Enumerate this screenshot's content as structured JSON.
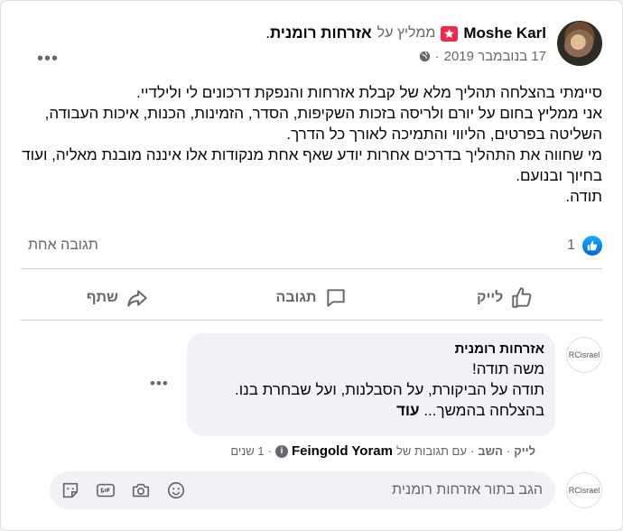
{
  "post": {
    "author_name": "Moshe Karl",
    "recommends_text": "ממליץ על",
    "page_name": "אזרחות רומנית",
    "page_name_suffix": ".",
    "date": "17 בנובמבר 2019",
    "date_separator": "·",
    "more_label": "•••",
    "body_lines": [
      "סיימתי בהצלחה תהליך מלא של קבלת אזרחות והנפקת דרכונים לי ולילדיי.",
      "אני ממליץ בחום על יורם ולריסה בזכות השקיפות, הסדר, הזמינות, הכנות, איכות העבודה, השליטה בפרטים, הליווי והתמיכה לאורך כל הדרך.",
      "מי שחווה את התהליך בדרכים אחרות יודע שאף אחת מנקודות אלו איננה מובנת מאליה, ועוד בחיוך ובנועם.",
      "תודה."
    ]
  },
  "reactions": {
    "like_count": "1",
    "comments_count": "תגובה אחת"
  },
  "actions": {
    "like": "לייק",
    "comment": "תגובה",
    "share": "שתף"
  },
  "comment": {
    "avatar_text": "RCisrael",
    "author": "אזרחות רומנית",
    "lines": [
      "משה תודה!",
      "תודה על הביקורת, על הסבלנות, ועל שבחרת בנו.",
      "בהצלחה בהמשך..."
    ],
    "more": "עוד",
    "more_dots": "•••",
    "meta": {
      "like": "לייק",
      "reply": "השב",
      "replied_by_prefix": "עם תגובות של",
      "replied_by_name": "Feingold Yoram",
      "time": "1 שנים",
      "separator": "·"
    }
  },
  "reply_box": {
    "avatar_text": "RCisrael",
    "placeholder": "הגב בתור אזרחות רומנית",
    "icons": [
      "smiley-icon",
      "camera-icon",
      "gif-icon",
      "sticker-icon"
    ]
  },
  "colors": {
    "accent": "#1877f2",
    "recommend": "#f02849",
    "muted": "#65676b",
    "bubble": "#f0f2f5"
  }
}
